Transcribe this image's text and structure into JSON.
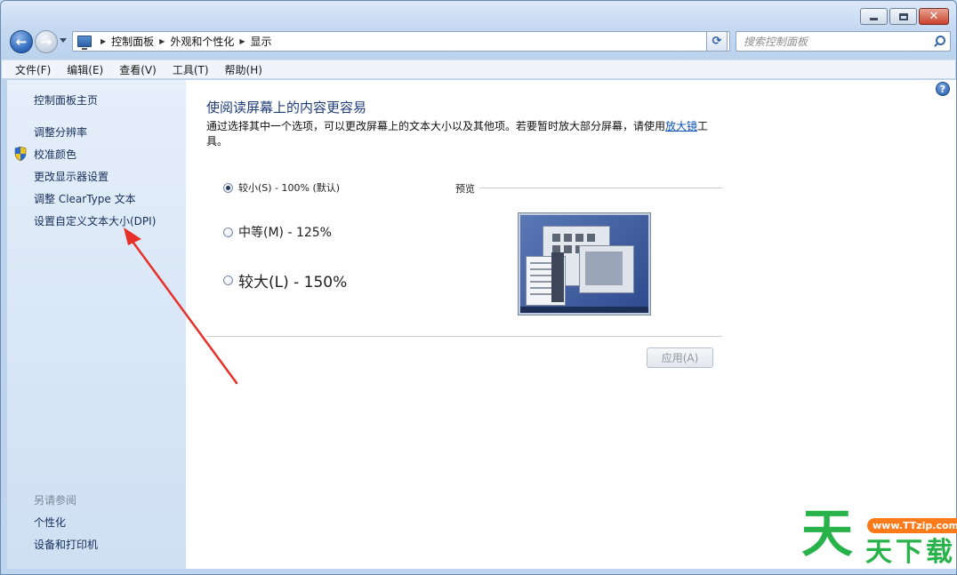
{
  "window": {
    "caption_buttons": {
      "minimize": "",
      "maximize": "",
      "close": "✕"
    }
  },
  "nav": {
    "breadcrumbs": [
      "控制面板",
      "外观和个性化",
      "显示"
    ],
    "search_placeholder": "搜索控制面板"
  },
  "menu": {
    "items": [
      "文件(F)",
      "编辑(E)",
      "查看(V)",
      "工具(T)",
      "帮助(H)"
    ]
  },
  "sidebar": {
    "home": "控制面板主页",
    "links": [
      "调整分辨率",
      "校准颜色",
      "更改显示器设置",
      "调整 ClearType 文本",
      "设置自定义文本大小(DPI)"
    ],
    "see_also_label": "另请参阅",
    "see_also": [
      "个性化",
      "设备和打印机"
    ]
  },
  "content": {
    "title": "使阅读屏幕上的内容更容易",
    "description_before": "通过选择其中一个选项，可以更改屏幕上的文本大小以及其他项。若要暂时放大部分屏幕，请使用",
    "description_link": "放大镜",
    "description_after": "工具。",
    "options": [
      {
        "label": "较小(S) - 100% (默认)",
        "checked": true
      },
      {
        "label": "中等(M) - 125%",
        "checked": false
      },
      {
        "label": "较大(L) - 150%",
        "checked": false
      }
    ],
    "preview_label": "预览",
    "apply_label": "应用(A)"
  },
  "icons": {
    "help": "?",
    "back": "←",
    "forward": "→",
    "refresh": "⟳"
  },
  "watermark": {
    "url": "www.TTzip.com",
    "big": "天",
    "chars": "天下载"
  },
  "colors": {
    "link": "#152e5a",
    "title": "#1e3c7a",
    "annotation_arrow": "#e8302a",
    "watermark_green": "#27b34a",
    "watermark_orange": "#ff7a1a"
  }
}
